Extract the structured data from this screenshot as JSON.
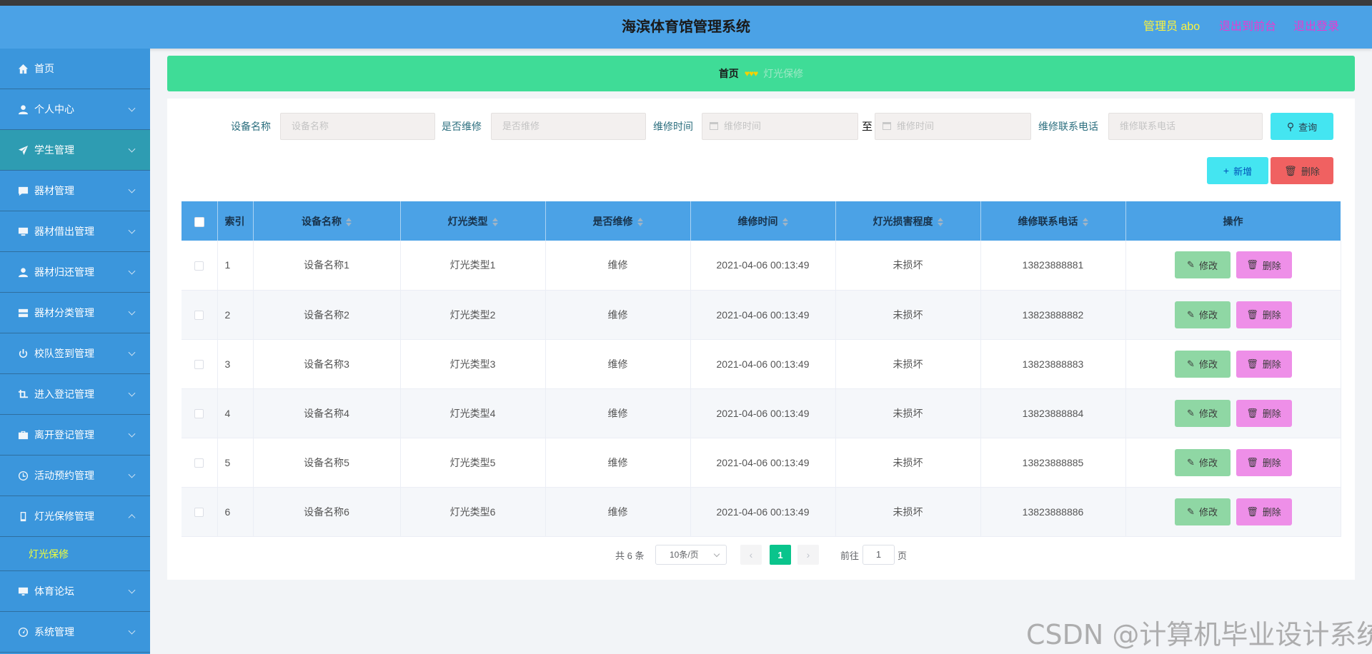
{
  "header": {
    "title": "海滨体育馆管理系统",
    "admin_label": "管理员 abo",
    "link_front": "退出到前台",
    "link_logout": "退出登录"
  },
  "sidebar": {
    "items": [
      {
        "label": "首页",
        "icon": "home-icon"
      },
      {
        "label": "个人中心",
        "icon": "user-icon"
      },
      {
        "label": "学生管理",
        "icon": "send-icon"
      },
      {
        "label": "器材管理",
        "icon": "chat-icon"
      },
      {
        "label": "器材借出管理",
        "icon": "message-icon"
      },
      {
        "label": "器材归还管理",
        "icon": "user-icon"
      },
      {
        "label": "器材分类管理",
        "icon": "server-icon"
      },
      {
        "label": "校队签到管理",
        "icon": "power-icon"
      },
      {
        "label": "进入登记管理",
        "icon": "crop-icon"
      },
      {
        "label": "离开登记管理",
        "icon": "briefcase-icon"
      },
      {
        "label": "活动预约管理",
        "icon": "clock-icon"
      },
      {
        "label": "灯光保修管理",
        "icon": "phone-icon"
      },
      {
        "label": "灯光保修",
        "icon": ""
      },
      {
        "label": "体育论坛",
        "icon": "monitor-icon"
      },
      {
        "label": "系统管理",
        "icon": "gauge-icon"
      }
    ]
  },
  "breadcrumb": {
    "home": "首页",
    "current": "灯光保修"
  },
  "filters": {
    "name_label": "设备名称",
    "name_placeholder": "设备名称",
    "repair_label": "是否维修",
    "repair_placeholder": "是否维修",
    "time_label": "维修时间",
    "time_start_placeholder": "维修时间",
    "time_sep": "至",
    "time_end_placeholder": "维修时间",
    "phone_label": "维修联系电话",
    "phone_placeholder": "维修联系电话",
    "search_button": "查询",
    "add_button": "新增",
    "delete_button": "删除"
  },
  "table": {
    "headers": [
      "索引",
      "设备名称",
      "灯光类型",
      "是否维修",
      "维修时间",
      "灯光损害程度",
      "维修联系电话",
      "操作"
    ],
    "edit_label": "修改",
    "delete_label": "删除",
    "rows": [
      {
        "index": "1",
        "name": "设备名称1",
        "type": "灯光类型1",
        "repair": "维修",
        "time": "2021-04-06 00:13:49",
        "damage": "未损坏",
        "phone": "13823888881"
      },
      {
        "index": "2",
        "name": "设备名称2",
        "type": "灯光类型2",
        "repair": "维修",
        "time": "2021-04-06 00:13:49",
        "damage": "未损坏",
        "phone": "13823888882"
      },
      {
        "index": "3",
        "name": "设备名称3",
        "type": "灯光类型3",
        "repair": "维修",
        "time": "2021-04-06 00:13:49",
        "damage": "未损坏",
        "phone": "13823888883"
      },
      {
        "index": "4",
        "name": "设备名称4",
        "type": "灯光类型4",
        "repair": "维修",
        "time": "2021-04-06 00:13:49",
        "damage": "未损坏",
        "phone": "13823888884"
      },
      {
        "index": "5",
        "name": "设备名称5",
        "type": "灯光类型5",
        "repair": "维修",
        "time": "2021-04-06 00:13:49",
        "damage": "未损坏",
        "phone": "13823888885"
      },
      {
        "index": "6",
        "name": "设备名称6",
        "type": "灯光类型6",
        "repair": "维修",
        "time": "2021-04-06 00:13:49",
        "damage": "未损坏",
        "phone": "13823888886"
      }
    ]
  },
  "pagination": {
    "total": "共 6 条",
    "page_size": "10条/页",
    "current_page": "1",
    "goto_label": "前往",
    "goto_value": "1",
    "goto_unit": "页"
  },
  "watermark": "CSDN @计算机毕业设计系统",
  "colors": {
    "header_bg": "#4ba2e6",
    "sidebar_bg": "#3b96dc",
    "breadcrumb_bg": "#3fdc97",
    "search_btn": "#44e5f1",
    "delete_btn": "#f06161",
    "edit_btn": "#8fd7a4",
    "row_delete_btn": "#ee8fe8",
    "active_page": "#0ac48c"
  }
}
